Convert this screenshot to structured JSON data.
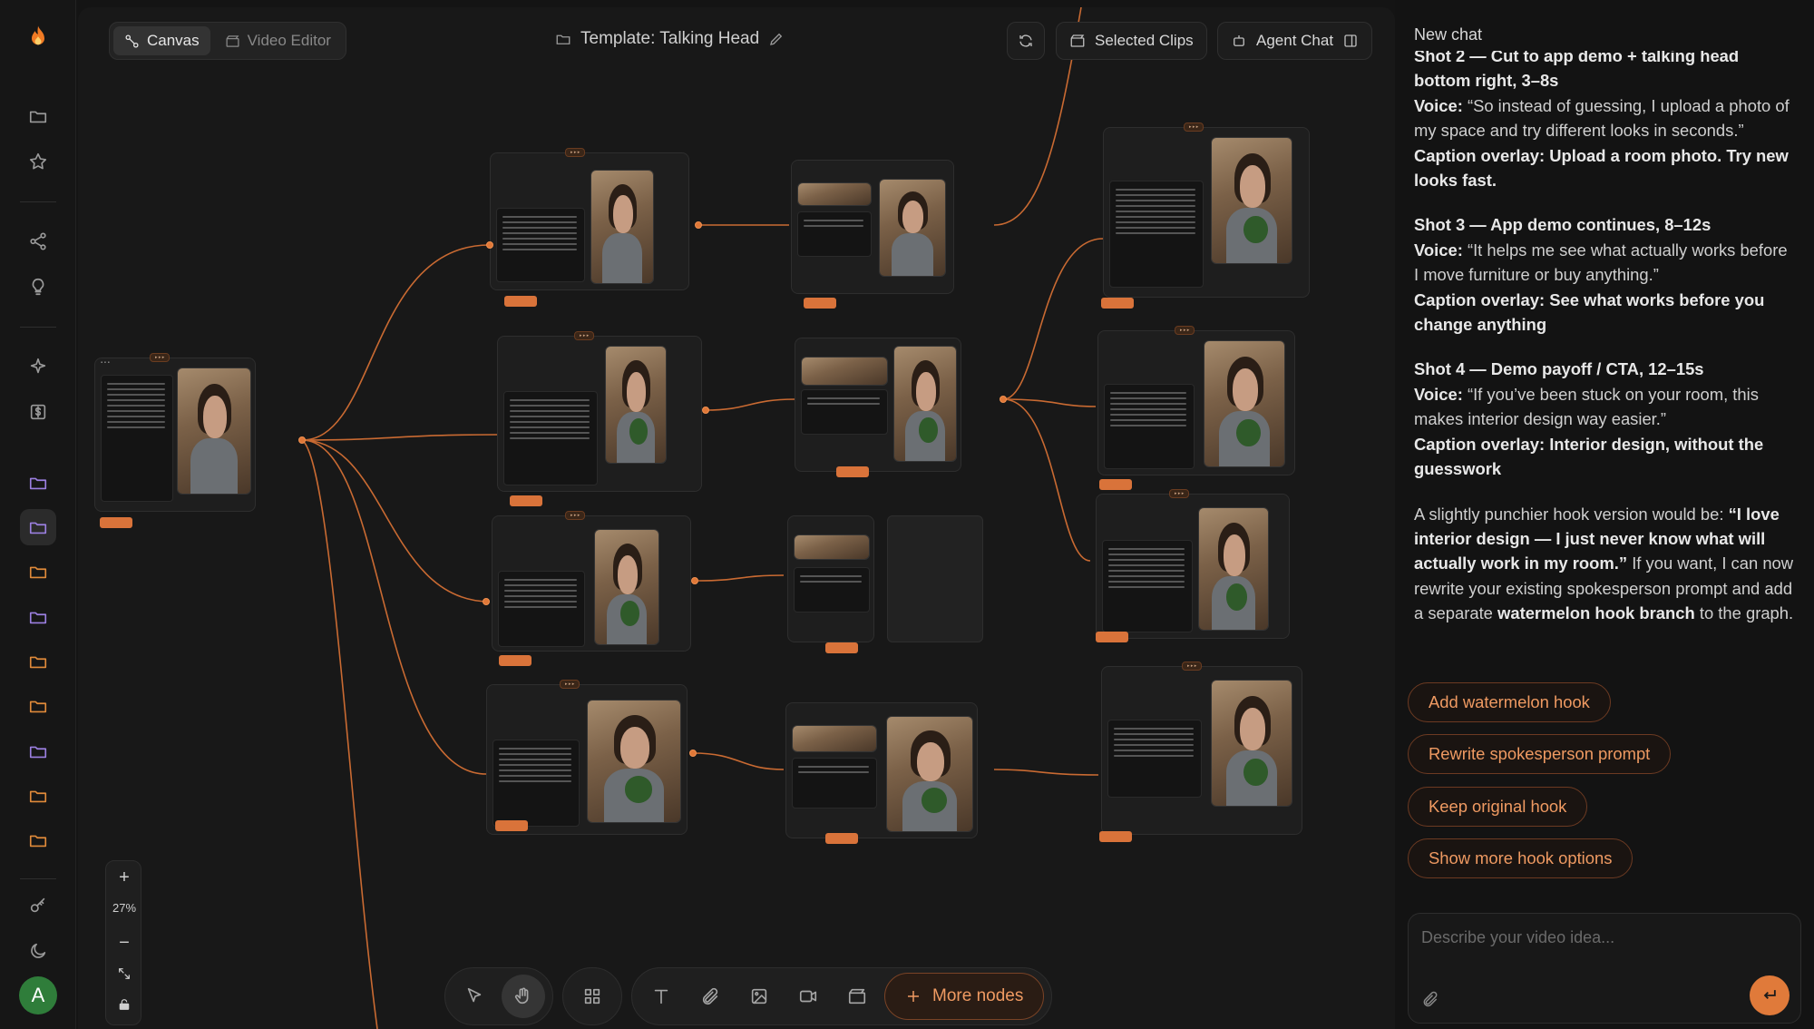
{
  "sidebar": {
    "icons": [
      "flame-logo-icon",
      "folder-icon",
      "star-icon",
      "share-icon",
      "lightbulb-icon",
      "sparkle-icon",
      "billing-icon",
      "folder-icon",
      "folder-icon",
      "folder-icon",
      "folder-icon",
      "folder-icon",
      "folder-icon",
      "folder-icon",
      "folder-icon",
      "folder-icon",
      "key-icon",
      "moon-icon"
    ],
    "avatar_letter": "A",
    "colors": {
      "folder_purple": "#9b7fe0",
      "folder_orange": "#e08a3a"
    }
  },
  "top": {
    "canvas_tab": "Canvas",
    "video_editor_tab": "Video Editor",
    "title": "Template: Talking Head",
    "selected_clips": "Selected Clips",
    "agent_chat": "Agent Chat"
  },
  "zoom": {
    "level": "27%"
  },
  "toolbar": {
    "more_nodes": "More nodes"
  },
  "chat": {
    "title": "New chat",
    "shot2_heading": "Shot 2 — Cut to app demo + talking head bottom right, 3–8s",
    "shot2_voice_label": "Voice:",
    "shot2_voice": "“So instead of guessing, I upload a photo of my space and try different looks in seconds.”",
    "shot2_caption": "Caption overlay: Upload a room photo. Try new looks fast.",
    "shot3_heading": "Shot 3 — App demo continues, 8–12s",
    "shot3_voice_label": "Voice:",
    "shot3_voice": "“It helps me see what actually works before I move furniture or buy anything.”",
    "shot3_caption": "Caption overlay: See what works before you change anything",
    "shot4_heading": "Shot 4 — Demo payoff / CTA, 12–15s",
    "shot4_voice_label": "Voice:",
    "shot4_voice": "“If you’ve been stuck on your room, this makes interior design way easier.”",
    "shot4_caption": "Caption overlay: Interior design, without the guesswork",
    "hook_intro": "A slightly punchier hook version would be:",
    "hook_quote": "“I love interior design — I just never know what will actually work in my room.”",
    "hook_mid": "If you want, I can now rewrite your existing spokesperson prompt and add a separate",
    "hook_bold": "watermelon hook branch",
    "hook_end": "to the graph.",
    "suggestions": [
      "Add watermelon hook",
      "Rewrite spokesperson prompt",
      "Keep original hook",
      "Show more hook options"
    ],
    "input_placeholder": "Describe your video idea..."
  }
}
